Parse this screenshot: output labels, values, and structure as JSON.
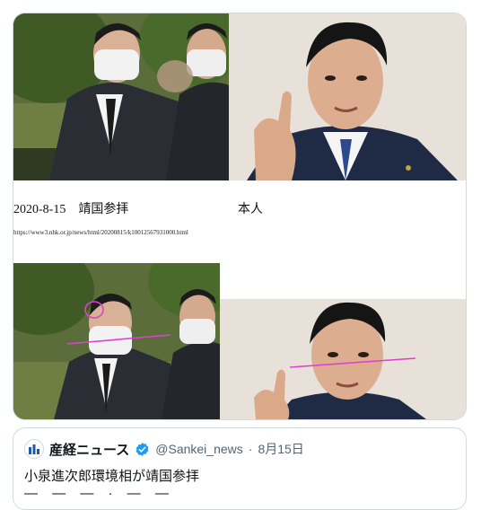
{
  "collage": {
    "caption_left": "2020-8-15　靖国参拝",
    "caption_right": "本人",
    "source_url": "https://www3.nhk.or.jp/news/html/20200815/k10012567931000.html"
  },
  "quoted_tweet": {
    "account_name": "産経ニュース",
    "handle": "@Sankei_news",
    "separator": "·",
    "date": "8月15日",
    "text": "小泉進次郎環境相が靖国参拝",
    "text_cut_off": "— — — · — —"
  },
  "icons": {
    "avatar": "sankei-logo-icon",
    "verified": "verified-badge-icon"
  },
  "colors": {
    "verified_blue": "#1d9bf0",
    "annotation_magenta": "#e040d0",
    "border": "#cfd9de",
    "secondary_text": "#536471"
  }
}
